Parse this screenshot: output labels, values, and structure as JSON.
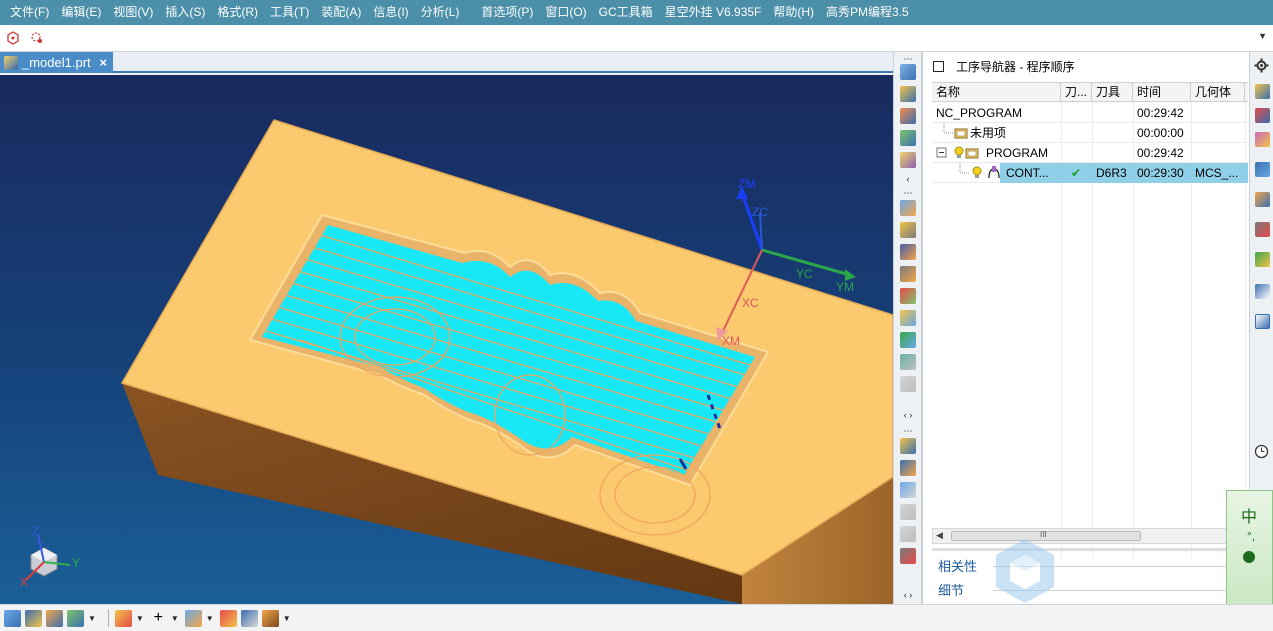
{
  "menubar": {
    "items": [
      {
        "label": "文件(F)"
      },
      {
        "label": "编辑(E)"
      },
      {
        "label": "视图(V)"
      },
      {
        "label": "插入(S)"
      },
      {
        "label": "格式(R)"
      },
      {
        "label": "工具(T)"
      },
      {
        "label": "装配(A)"
      },
      {
        "label": "信息(I)"
      },
      {
        "label": "分析(L)"
      },
      {
        "label": "首选项(P)"
      },
      {
        "label": "窗口(O)"
      },
      {
        "label": "GC工具箱"
      },
      {
        "label": "星空外挂 V6.935F"
      },
      {
        "label": "帮助(H)"
      },
      {
        "label": "高秀PM编程3.5"
      }
    ]
  },
  "document_tab": {
    "label": "_model1.prt",
    "close_glyph": "×"
  },
  "viewport": {
    "axis_labels": {
      "zm": "ZM",
      "zc": "ZC",
      "yc": "YC",
      "ym": "YM",
      "xc": "XC",
      "xm": "XM"
    },
    "triad_labels": {
      "z": "Z",
      "y": "Y",
      "x": "X"
    },
    "colors": {
      "block_top": "#fbc96e",
      "block_side_front": "#7a4a1e",
      "block_side_right": "#b67a3a",
      "toolpath": "#00f0ff"
    }
  },
  "navigator": {
    "title": "工序导航器 - 程序顺序",
    "columns": [
      "名称",
      "刀...",
      "刀具",
      "时间",
      "几何体"
    ],
    "rows": [
      {
        "name": "NC_PROGRAM",
        "tool_status": "",
        "tool": "",
        "time": "00:29:42",
        "geometry": ""
      },
      {
        "name": "未用项",
        "tool_status": "",
        "tool": "",
        "time": "00:00:00",
        "geometry": ""
      },
      {
        "name": "PROGRAM",
        "tool_status": "",
        "tool": "",
        "time": "00:29:42",
        "geometry": ""
      },
      {
        "name": "CONT...",
        "tool_status": "✔",
        "tool": "D6R3",
        "time": "00:29:30",
        "geometry": "MCS_..."
      }
    ],
    "scroll_mark": "III",
    "panels": {
      "dependencies": "相关性",
      "details": "细节"
    }
  },
  "ime": {
    "mode": "中",
    "punct": "°,"
  }
}
